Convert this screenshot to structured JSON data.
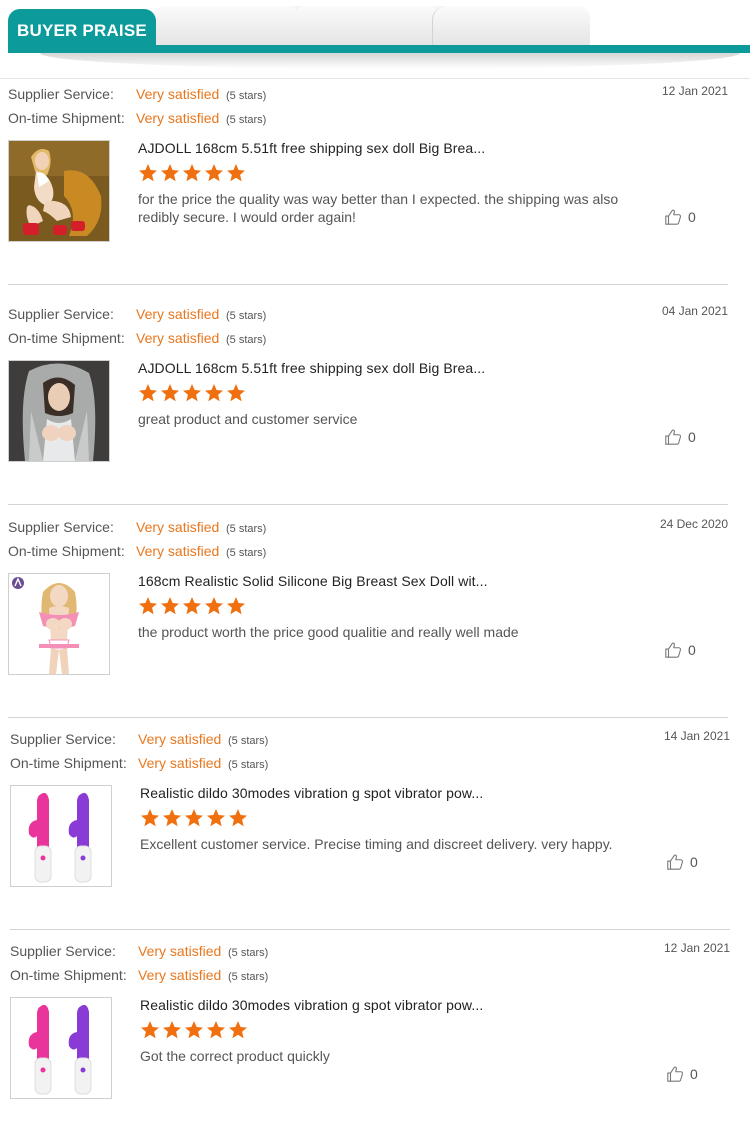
{
  "header": {
    "active_tab": "BUYER PRAISE"
  },
  "colors": {
    "teal": "#0d9a9a",
    "accent_orange": "#e8771e",
    "star_orange": "#f0700f"
  },
  "reviews": [
    {
      "supplier_label": "Supplier Service:",
      "supplier_value": "Very satisfied",
      "supplier_stars": "(5 stars)",
      "shipment_label": "On-time Shipment:",
      "shipment_value": "Very satisfied",
      "shipment_stars": "(5 stars)",
      "date": "12 Jan 2021",
      "product_title": "AJDOLL 168cm 5.51ft free shipping sex doll Big Brea...",
      "rating": 5,
      "comment": "for the price the quality was way better than I expected. the shipping was also redibly secure. I would order again!",
      "likes": "0",
      "image_icon": "product-photo-doll-seated"
    },
    {
      "supplier_label": "Supplier Service:",
      "supplier_value": "Very satisfied",
      "supplier_stars": "(5 stars)",
      "shipment_label": "On-time Shipment:",
      "shipment_value": "Very satisfied",
      "shipment_stars": "(5 stars)",
      "date": "04 Jan 2021",
      "product_title": "AJDOLL 168cm 5.51ft free shipping sex doll Big Brea...",
      "rating": 5,
      "comment": "great product and customer service",
      "likes": "0",
      "image_icon": "product-photo-doll-hoodie"
    },
    {
      "supplier_label": "Supplier Service:",
      "supplier_value": "Very satisfied",
      "supplier_stars": "(5 stars)",
      "shipment_label": "On-time Shipment:",
      "shipment_value": "Very satisfied",
      "shipment_stars": "(5 stars)",
      "date": "24 Dec 2020",
      "product_title": "168cm Realistic Solid Silicone Big Breast Sex Doll wit...",
      "rating": 5,
      "comment": "the product worth the price good qualitie and really well made",
      "likes": "0",
      "image_icon": "product-photo-doll-standing"
    },
    {
      "supplier_label": "Supplier Service:",
      "supplier_value": "Very satisfied",
      "supplier_stars": "(5 stars)",
      "shipment_label": "On-time Shipment:",
      "shipment_value": "Very satisfied",
      "shipment_stars": "(5 stars)",
      "date": "14 Jan 2021",
      "product_title": "Realistic dildo 30modes vibration g spot vibrator pow...",
      "rating": 5,
      "comment": "Excellent customer service. Precise timing and discreet delivery. very happy.",
      "likes": "0",
      "image_icon": "product-photo-vibrators"
    },
    {
      "supplier_label": "Supplier Service:",
      "supplier_value": "Very satisfied",
      "supplier_stars": "(5 stars)",
      "shipment_label": "On-time Shipment:",
      "shipment_value": "Very satisfied",
      "shipment_stars": "(5 stars)",
      "date": "12 Jan 2021",
      "product_title": "Realistic dildo 30modes vibration g spot vibrator pow...",
      "rating": 5,
      "comment": "Got the correct product quickly",
      "likes": "0",
      "image_icon": "product-photo-vibrators"
    }
  ]
}
